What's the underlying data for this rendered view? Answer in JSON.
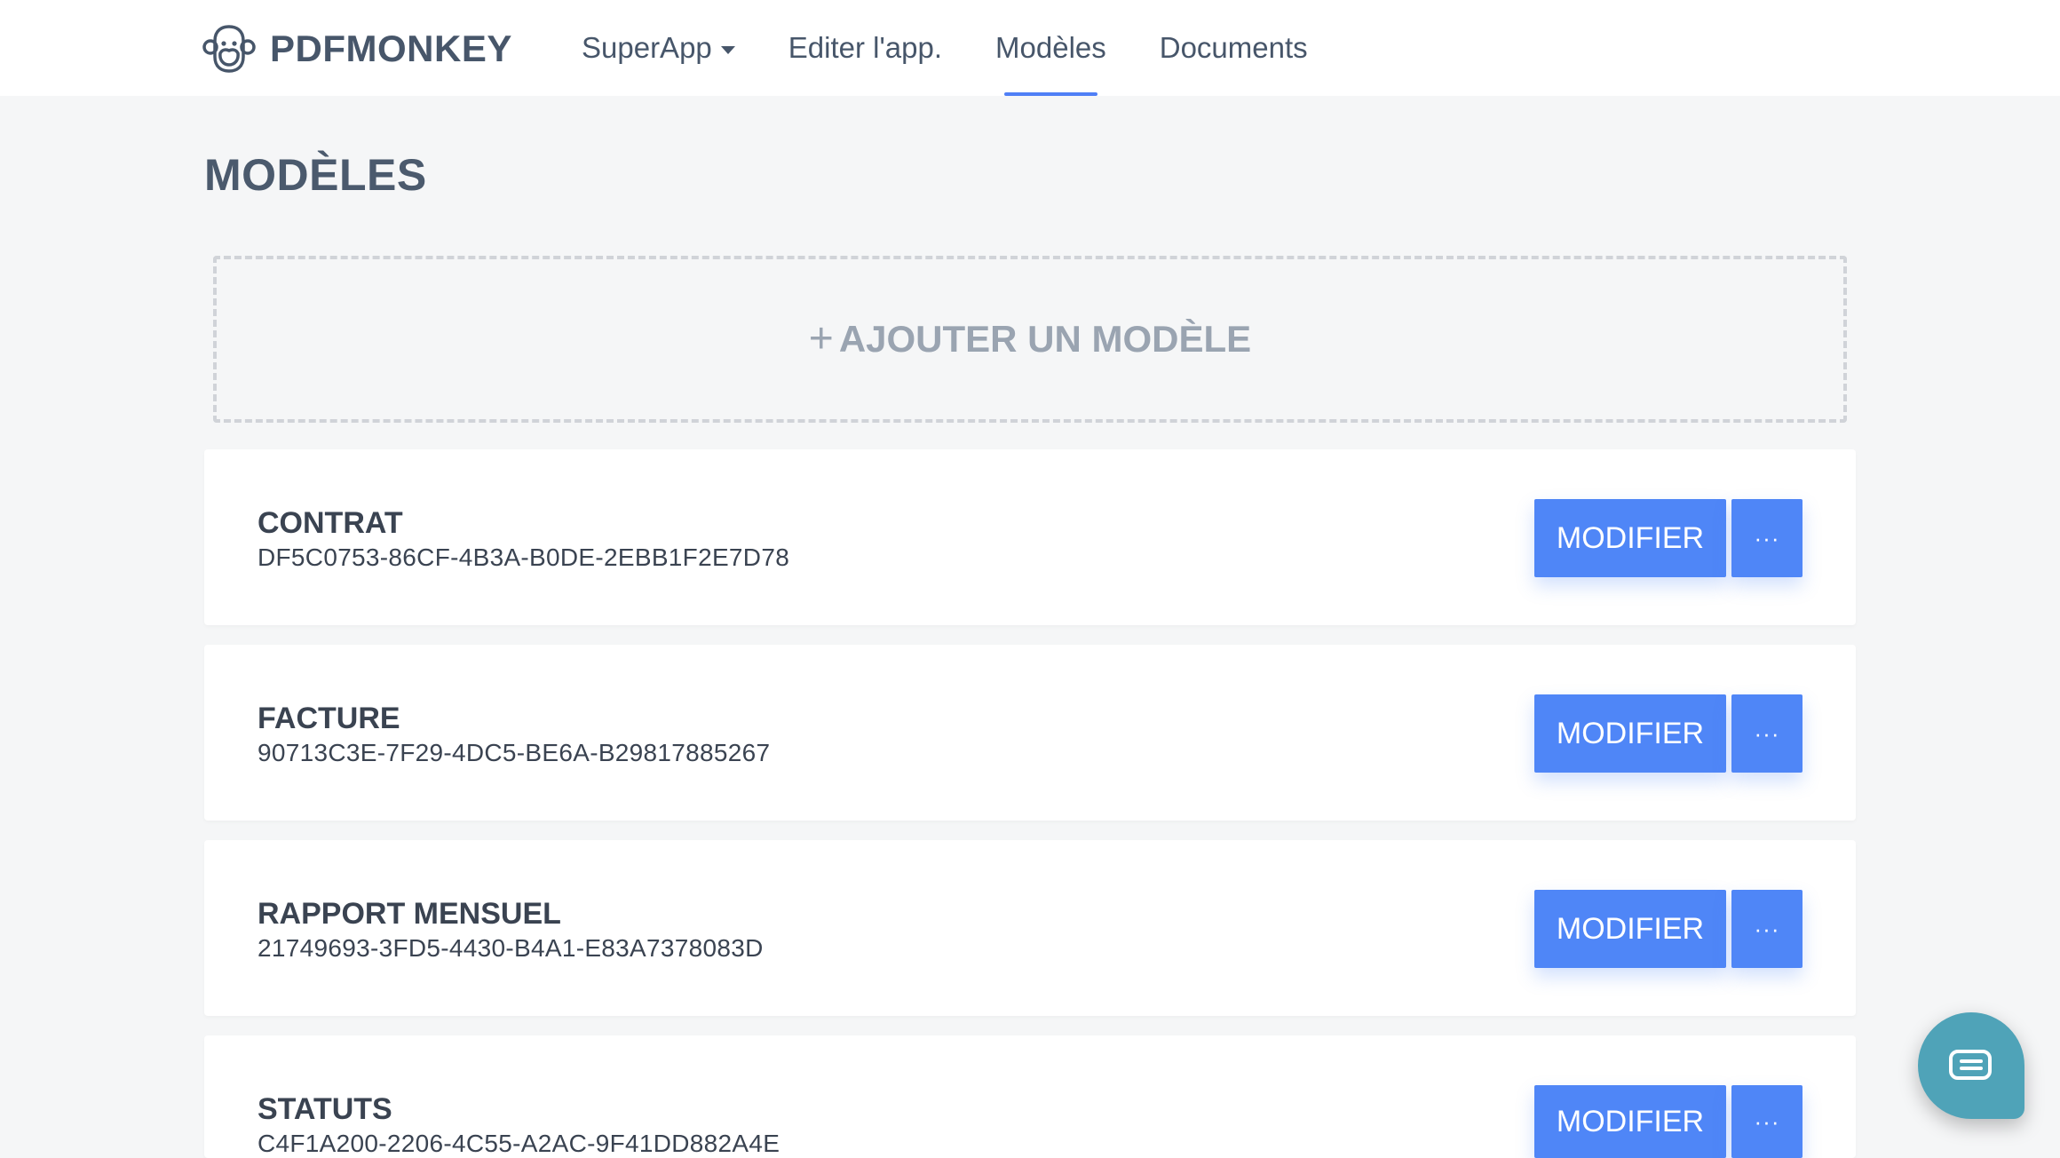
{
  "brand": {
    "name": "PDFMONKEY",
    "logo_icon": "monkey-icon"
  },
  "nav": {
    "items": [
      {
        "label": "SuperApp",
        "has_dropdown": true
      },
      {
        "label": "Editer l'app."
      },
      {
        "label": "Modèles",
        "active": true
      },
      {
        "label": "Documents"
      }
    ]
  },
  "page": {
    "title": "MODÈLES"
  },
  "add_template": {
    "icon": "plus-icon",
    "label": "AJOUTER UN MODÈLE"
  },
  "templates": [
    {
      "name": "CONTRAT",
      "id": "DF5C0753-86CF-4B3A-B0DE-2EBB1F2E7D78",
      "modify_label": "MODIFIER",
      "more_label": "···"
    },
    {
      "name": "FACTURE",
      "id": "90713C3E-7F29-4DC5-BE6A-B29817885267",
      "modify_label": "MODIFIER",
      "more_label": "···"
    },
    {
      "name": "RAPPORT MENSUEL",
      "id": "21749693-3FD5-4430-B4A1-E83A7378083D",
      "modify_label": "MODIFIER",
      "more_label": "···"
    },
    {
      "name": "STATUTS",
      "id": "C4F1A200-2206-4C55-A2AC-9F41DD882A4E",
      "modify_label": "MODIFIER",
      "more_label": "···"
    }
  ],
  "chat": {
    "icon": "chat-icon"
  },
  "colors": {
    "accent": "#4f86f7",
    "nav_underline": "#4f7ff6",
    "chat": "#4fa3b8",
    "background": "#f5f6f7"
  }
}
